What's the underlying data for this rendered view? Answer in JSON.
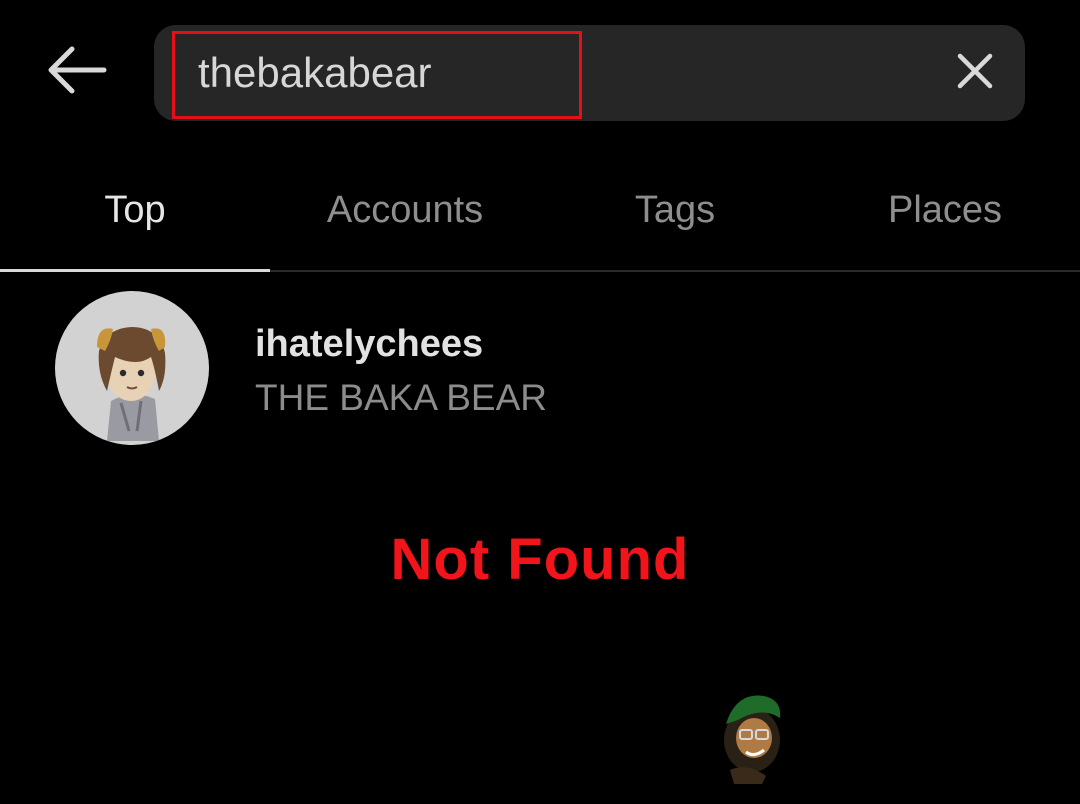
{
  "header": {
    "back_icon": "arrow-left-icon",
    "search": {
      "value": "thebakabear",
      "placeholder": "Search",
      "clear_icon": "close-icon",
      "highlight_color": "#e3101a"
    }
  },
  "tabs": [
    {
      "label": "Top",
      "active": true
    },
    {
      "label": "Accounts",
      "active": false
    },
    {
      "label": "Tags",
      "active": false
    },
    {
      "label": "Places",
      "active": false
    }
  ],
  "results": [
    {
      "username": "ihatelychees",
      "full_name": "THE BAKA BEAR",
      "avatar_icon": "cartoon-bear-avatar"
    }
  ],
  "annotation": {
    "text": "Not Found",
    "color": "#f1141b"
  },
  "colors": {
    "background": "#000000",
    "search_background": "#262626",
    "active_tab": "#e6e6e6",
    "inactive_tab": "#8e8e8e"
  }
}
